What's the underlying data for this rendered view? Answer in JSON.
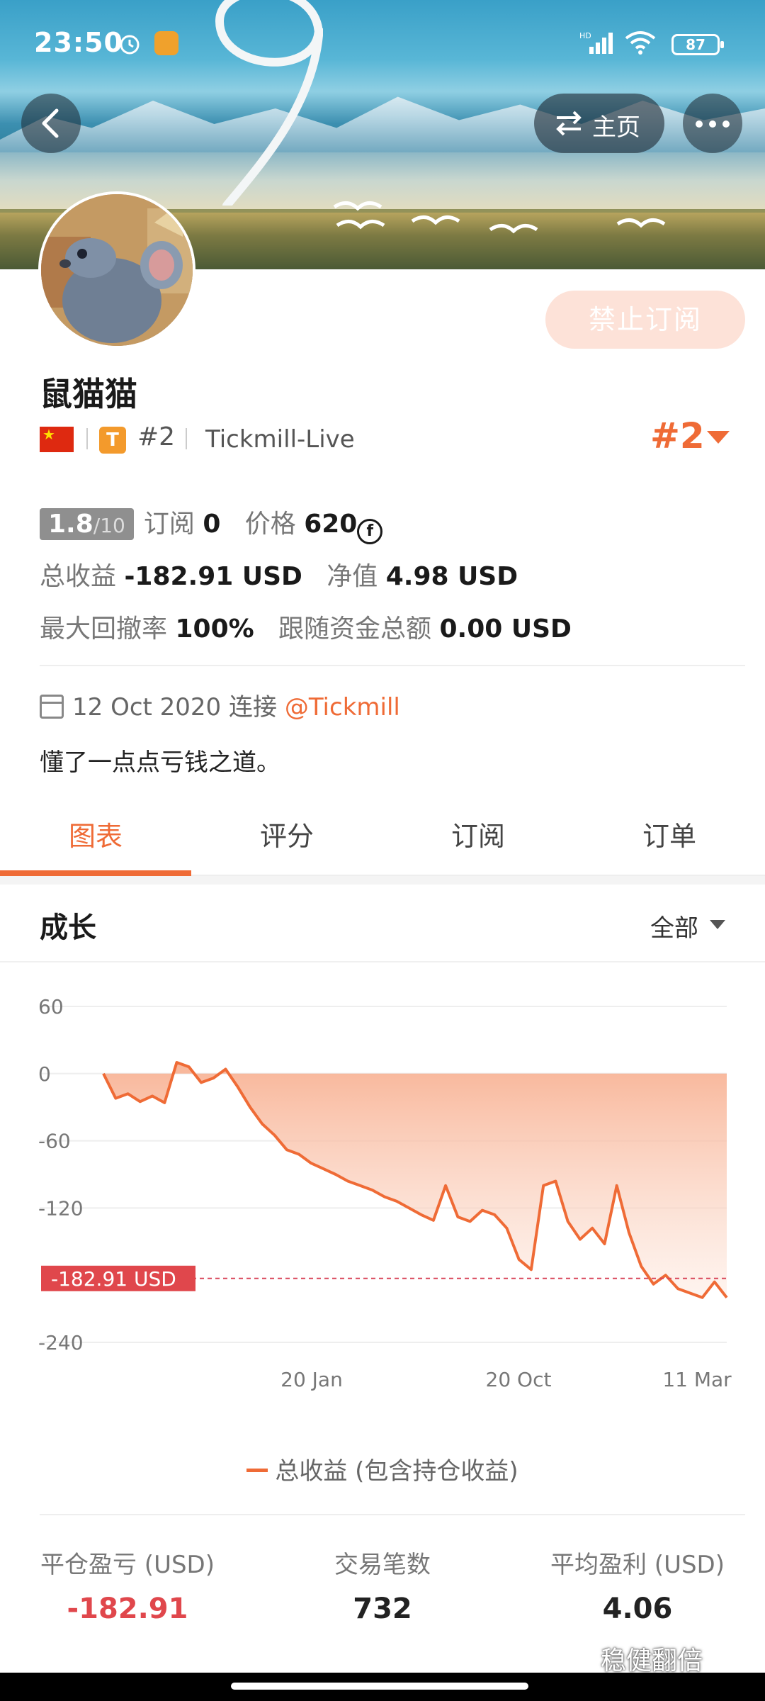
{
  "status_bar": {
    "time": "23:50",
    "battery": "87"
  },
  "nav": {
    "home_label": "主页"
  },
  "profile": {
    "subscribe_disabled_label": "禁止订阅",
    "name": "鼠猫猫",
    "rank_small": "#2",
    "broker": "Tickmill-Live",
    "rank_big": "#2"
  },
  "stats": {
    "score": "1.8",
    "score_max": "/10",
    "subscriptions_label": "订阅",
    "subscriptions_value": "0",
    "price_label": "价格",
    "price_value": "620",
    "total_profit_label": "总收益",
    "total_profit_value": "-182.91 USD",
    "equity_label": "净值",
    "equity_value": "4.98 USD",
    "max_drawdown_label": "最大回撤率",
    "max_drawdown_value": "100%",
    "follow_funds_label": "跟随资金总额",
    "follow_funds_value": "0.00 USD"
  },
  "connection": {
    "date": "12 Oct 2020",
    "connect_label": "连接",
    "link": "@Tickmill"
  },
  "bio": "懂了一点点亏钱之道。",
  "tabs": [
    {
      "label": "图表",
      "active": true
    },
    {
      "label": "评分",
      "active": false
    },
    {
      "label": "订阅",
      "active": false
    },
    {
      "label": "订单",
      "active": false
    }
  ],
  "growth": {
    "title": "成长",
    "range": "全部"
  },
  "chart_data": {
    "type": "area",
    "y_ticks": [
      "60",
      "0",
      "-60",
      "-120",
      "-240"
    ],
    "x_ticks": [
      "20 Jan",
      "20 Oct",
      "11 Mar"
    ],
    "ylim": [
      -240,
      60
    ],
    "current_label": "-182.91 USD",
    "current_value": -182.91,
    "series": [
      {
        "name": "总收益 (包含持仓收益)",
        "color": "#ef6b36",
        "values": [
          0,
          -22,
          -18,
          -25,
          -20,
          -26,
          10,
          6,
          -8,
          -4,
          4,
          -12,
          -30,
          -45,
          -55,
          -68,
          -72,
          -80,
          -85,
          -90,
          -96,
          -100,
          -104,
          -110,
          -114,
          -120,
          -126,
          -131,
          -100,
          -128,
          -132,
          -122,
          -126,
          -138,
          -166,
          -175,
          -100,
          -96,
          -132,
          -148,
          -138,
          -152,
          -100,
          -142,
          -172,
          -188,
          -180,
          -192,
          -196,
          -200,
          -186,
          -200
        ]
      }
    ],
    "legend": "总收益 (包含持仓收益)"
  },
  "summary": [
    {
      "label": "平仓盈亏 (USD)",
      "value": "-182.91",
      "negative": true
    },
    {
      "label": "交易笔数",
      "value": "732",
      "negative": false
    },
    {
      "label": "平均盈利 (USD)",
      "value": "4.06",
      "negative": false
    }
  ],
  "watermark": "稳健翻倍"
}
